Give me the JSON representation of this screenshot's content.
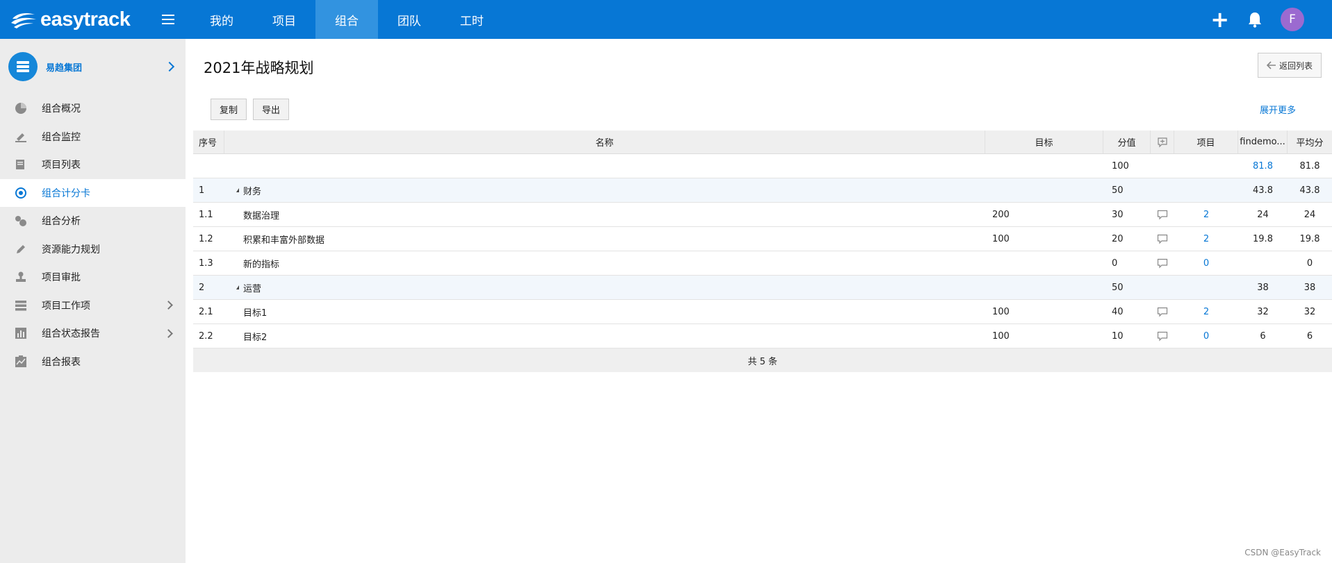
{
  "topbar": {
    "logo": "easytrack",
    "nav": [
      "我的",
      "项目",
      "组合",
      "团队",
      "工时"
    ],
    "active_nav": 2,
    "avatar_letter": "F"
  },
  "sidebar": {
    "org_name": "易趋集团",
    "items": [
      {
        "label": "组合概况",
        "icon": "pie-chart-icon",
        "active": false,
        "chevron": false
      },
      {
        "label": "组合监控",
        "icon": "gavel-icon",
        "active": false,
        "chevron": false
      },
      {
        "label": "项目列表",
        "icon": "list-icon",
        "active": false,
        "chevron": false
      },
      {
        "label": "组合计分卡",
        "icon": "target-icon",
        "active": true,
        "chevron": false
      },
      {
        "label": "组合分析",
        "icon": "bubbles-icon",
        "active": false,
        "chevron": false
      },
      {
        "label": "资源能力规划",
        "icon": "pen-icon",
        "active": false,
        "chevron": false
      },
      {
        "label": "项目审批",
        "icon": "stamp-icon",
        "active": false,
        "chevron": false
      },
      {
        "label": "项目工作项",
        "icon": "stack-icon",
        "active": false,
        "chevron": true
      },
      {
        "label": "组合状态报告",
        "icon": "bar-chart-icon",
        "active": false,
        "chevron": true
      },
      {
        "label": "组合报表",
        "icon": "clipboard-chart-icon",
        "active": false,
        "chevron": false
      }
    ]
  },
  "main": {
    "title": "2021年战略规划",
    "back_label": "返回列表",
    "copy_label": "复制",
    "export_label": "导出",
    "expand_label": "展开更多"
  },
  "table": {
    "headers": {
      "seq": "序号",
      "name": "名称",
      "target": "目标",
      "score": "分值",
      "project": "项目",
      "findemo": "findemo...",
      "avg": "平均分"
    },
    "rows": [
      {
        "seq": "",
        "name": "",
        "target": "",
        "score": "100",
        "comment": false,
        "project": "",
        "findemo": "81.8",
        "findemo_link": true,
        "avg": "81.8",
        "group": false,
        "toggle": false
      },
      {
        "seq": "1",
        "name": "财务",
        "target": "",
        "score": "50",
        "comment": false,
        "project": "",
        "findemo": "43.8",
        "findemo_link": false,
        "avg": "43.8",
        "group": true,
        "toggle": true
      },
      {
        "seq": "1.1",
        "name": "数据治理",
        "target": "200",
        "score": "30",
        "comment": true,
        "project": "2",
        "findemo": "24",
        "findemo_link": false,
        "avg": "24",
        "group": false,
        "toggle": false
      },
      {
        "seq": "1.2",
        "name": "积累和丰富外部数据",
        "target": "100",
        "score": "20",
        "comment": true,
        "project": "2",
        "findemo": "19.8",
        "findemo_link": false,
        "avg": "19.8",
        "group": false,
        "toggle": false
      },
      {
        "seq": "1.3",
        "name": "新的指标",
        "target": "",
        "score": "0",
        "comment": true,
        "project": "0",
        "findemo": "",
        "findemo_link": false,
        "avg": "0",
        "group": false,
        "toggle": false
      },
      {
        "seq": "2",
        "name": "运营",
        "target": "",
        "score": "50",
        "comment": false,
        "project": "",
        "findemo": "38",
        "findemo_link": false,
        "avg": "38",
        "group": true,
        "toggle": true
      },
      {
        "seq": "2.1",
        "name": "目标1",
        "target": "100",
        "score": "40",
        "comment": true,
        "project": "2",
        "findemo": "32",
        "findemo_link": false,
        "avg": "32",
        "group": false,
        "toggle": false
      },
      {
        "seq": "2.2",
        "name": "目标2",
        "target": "100",
        "score": "10",
        "comment": true,
        "project": "0",
        "findemo": "6",
        "findemo_link": false,
        "avg": "6",
        "group": false,
        "toggle": false
      }
    ],
    "footer": "共 5 条"
  },
  "watermark": "CSDN @EasyTrack"
}
